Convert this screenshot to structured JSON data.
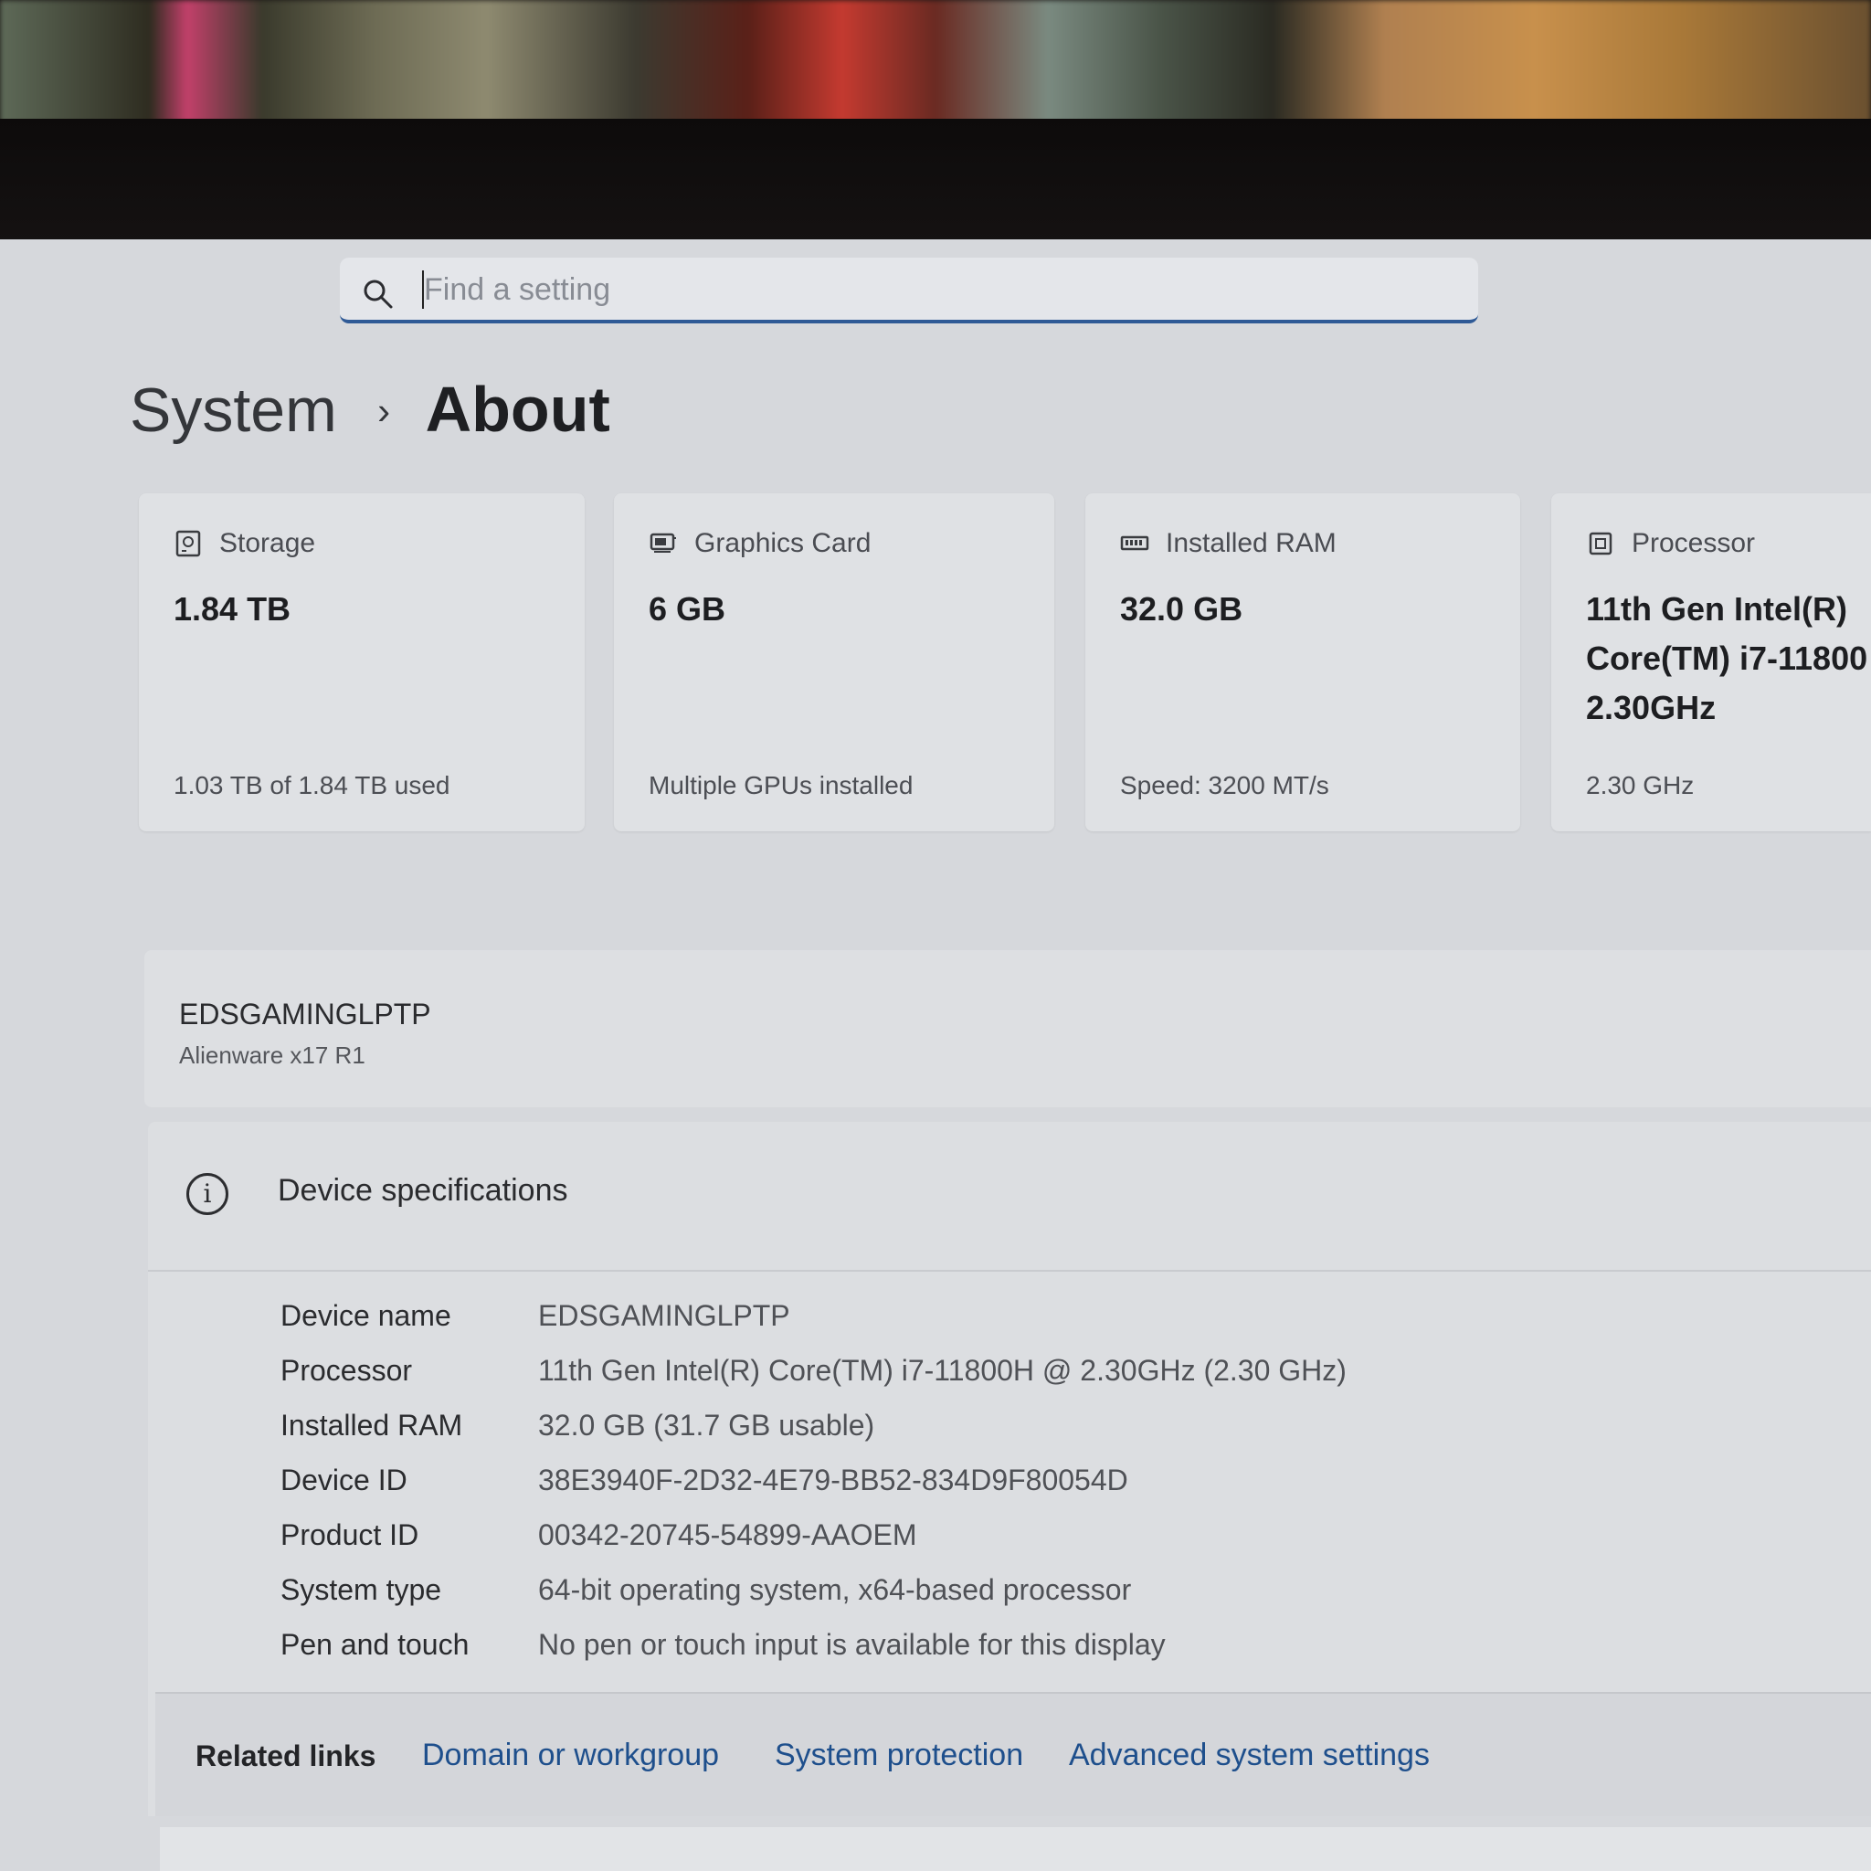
{
  "search": {
    "placeholder": "Find a setting",
    "icon": "search-icon"
  },
  "breadcrumb": {
    "parent": "System",
    "separator": "›",
    "current": "About"
  },
  "cards": [
    {
      "icon": "storage-icon",
      "label": "Storage",
      "value": "1.84 TB",
      "sub": "1.03 TB of 1.84 TB used"
    },
    {
      "icon": "graphics-card-icon",
      "label": "Graphics Card",
      "value": "6 GB",
      "sub": "Multiple GPUs installed"
    },
    {
      "icon": "ram-icon",
      "label": "Installed RAM",
      "value": "32.0 GB",
      "sub": "Speed: 3200 MT/s"
    },
    {
      "icon": "processor-icon",
      "label": "Processor",
      "value_lines": [
        "11th Gen Intel(R)",
        "Core(TM) i7-11800",
        "2.30GHz"
      ],
      "sub": "2.30 GHz"
    }
  ],
  "device": {
    "name": "EDSGAMINGLPTP",
    "model": "Alienware x17 R1"
  },
  "specs": {
    "title": "Device specifications",
    "icon": "info-icon",
    "rows": [
      {
        "label": "Device name",
        "value": "EDSGAMINGLPTP"
      },
      {
        "label": "Processor",
        "value": "11th Gen Intel(R) Core(TM) i7-11800H @ 2.30GHz (2.30 GHz)"
      },
      {
        "label": "Installed RAM",
        "value": "32.0 GB (31.7 GB usable)"
      },
      {
        "label": "Device ID",
        "value": "38E3940F-2D32-4E79-BB52-834D9F80054D"
      },
      {
        "label": "Product ID",
        "value": "00342-20745-54899-AAOEM"
      },
      {
        "label": "System type",
        "value": "64-bit operating system, x64-based processor"
      },
      {
        "label": "Pen and touch",
        "value": "No pen or touch input is available for this display"
      }
    ]
  },
  "related": {
    "label": "Related links",
    "links": [
      "Domain or workgroup",
      "System protection",
      "Advanced system settings"
    ]
  }
}
